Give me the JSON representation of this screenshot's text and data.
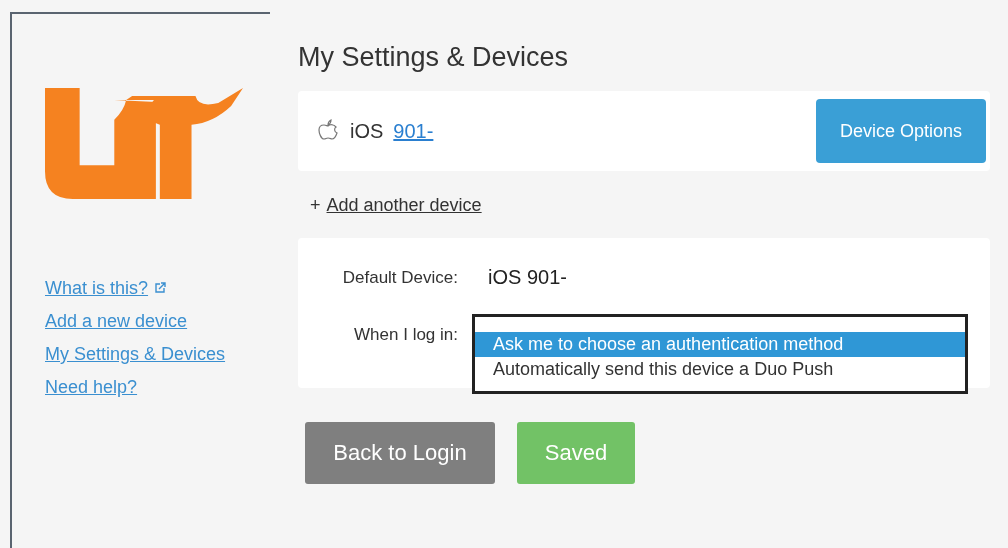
{
  "sidebar": {
    "links": [
      "What is this?",
      "Add a new device",
      "My Settings & Devices",
      "Need help?"
    ]
  },
  "title": "My Settings & Devices",
  "device": {
    "platform": "iOS",
    "number": "901-",
    "options_button": "Device Options"
  },
  "add_device": {
    "prefix": "+",
    "link": "Add another device"
  },
  "settings": {
    "default_label": "Default Device:",
    "default_value": "iOS 901-",
    "login_label": "When I log in:",
    "options": [
      {
        "label": "Ask me to choose an authentication method",
        "selected": true
      },
      {
        "label": "Automatically send this device a Duo Push",
        "selected": false
      }
    ]
  },
  "buttons": [
    {
      "label": "Back to Login",
      "kind": "secondary"
    },
    {
      "label": "Saved",
      "kind": "success"
    }
  ]
}
